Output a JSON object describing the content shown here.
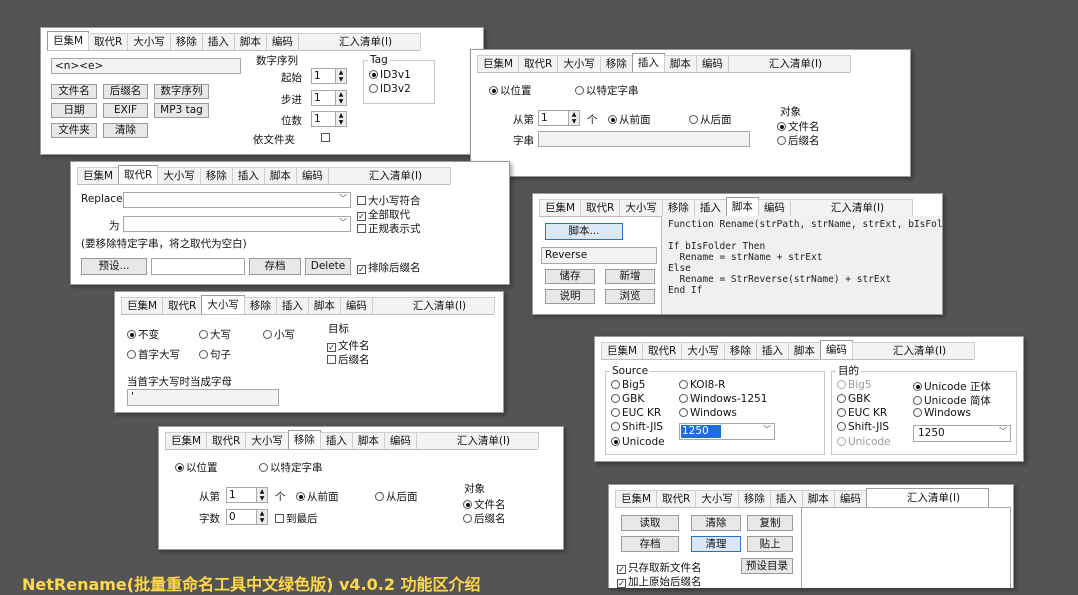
{
  "tabs": {
    "t1": "巨集M",
    "t2": "取代R",
    "t3": "大小写",
    "t4": "移除",
    "t5": "插入",
    "t6": "脚本",
    "t7": "编码",
    "t8": "汇入清单(I)"
  },
  "p1": {
    "pattern": "<n><e>",
    "b_name": "文件名",
    "b_ext": "后缀名",
    "b_seq": "数字序列",
    "b_date": "日期",
    "b_exif": "EXIF",
    "b_mp3": "MP3 tag",
    "b_folder": "文件夹",
    "b_clear": "清除",
    "seq_group": "数字序列",
    "start": "起始",
    "start_v": "1",
    "step": "步进",
    "step_v": "1",
    "digits": "位数",
    "digits_v": "1",
    "by_folder": "依文件夹",
    "tag_group": "Tag",
    "id3v1": "ID3v1",
    "id3v2": "ID3v2"
  },
  "p2": {
    "by_pos": "以位置",
    "by_str": "以特定字串",
    "from": "从第",
    "from_v": "1",
    "unit": "个",
    "front": "从前面",
    "back": "从后面",
    "str": "字串",
    "target": "对象",
    "t_name": "文件名",
    "t_ext": "后缀名"
  },
  "p3": {
    "replace": "Replace",
    "with": "为",
    "case": "大小写符合",
    "all": "全部取代",
    "regex": "正规表示式",
    "hint": "(要移除特定字串，将之取代为空白)",
    "preset": "预设...",
    "save": "存档",
    "delete": "Delete",
    "excl": "排除后缀名"
  },
  "p4": {
    "script": "脚本...",
    "name": "Reverse",
    "save": "储存",
    "new": "新增",
    "help": "说明",
    "browse": "浏览",
    "code": "Function Rename(strPath, strName, strExt, bIsFolder)\n\nIf bIsFolder Then\n  Rename = strName + strExt\nElse\n  Rename = StrReverse(strName) + strExt\nEnd If"
  },
  "p5": {
    "keep": "不变",
    "upper": "大写",
    "lower": "小写",
    "title": "首字大写",
    "sentence": "句子",
    "target": "目标",
    "t_name": "文件名",
    "t_ext": "后缀名",
    "caps_label": "当首字大写时当成字母",
    "caps_v": "'"
  },
  "p6": {
    "source": "Source",
    "dest": "目的",
    "big5": "Big5",
    "koi8": "KOI8-R",
    "gbk": "GBK",
    "win1251": "Windows-1251",
    "euckr": "EUC KR",
    "windows": "Windows",
    "sjis": "Shift-JIS",
    "unicode": "Unicode",
    "cp": "1250",
    "uni_trad": "Unicode 正体",
    "uni_simp": "Unicode 简体"
  },
  "p7": {
    "by_pos": "以位置",
    "by_str": "以特定字串",
    "from": "从第",
    "from_v": "1",
    "unit": "个",
    "front": "从前面",
    "back": "从后面",
    "count": "字数",
    "count_v": "0",
    "to_end": "到最后",
    "target": "对象",
    "t_name": "文件名",
    "t_ext": "后缀名"
  },
  "p8": {
    "read": "读取",
    "clear": "清除",
    "copy": "复制",
    "save": "存档",
    "clean": "清理",
    "paste": "贴上",
    "only_new": "只存取新文件名",
    "add_orig": "加上原始后缀名",
    "preset_dir": "预设目录"
  },
  "caption": "NetRename(批量重命名工具中文绿色版) v4.0.2 功能区介绍",
  "colors": {
    "background": "#545454",
    "accent": "#1e6fd9",
    "caption": "#ffd84a"
  }
}
